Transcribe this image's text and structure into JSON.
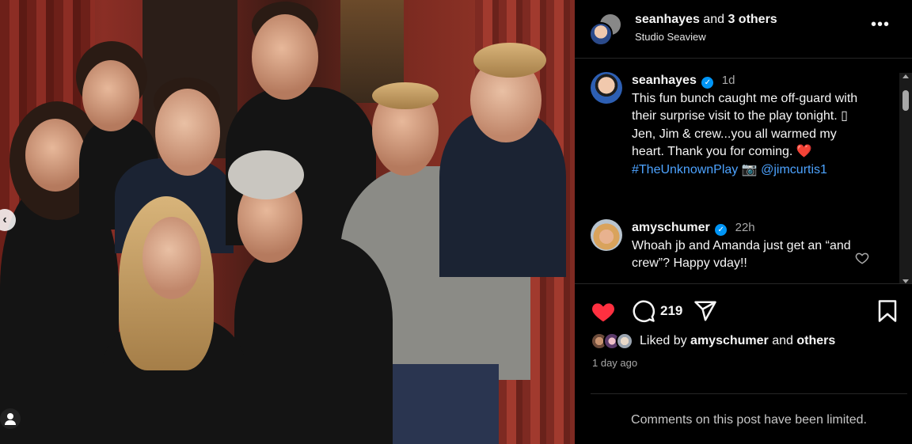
{
  "header": {
    "username": "seanhayes",
    "and_text": "and",
    "others": "3 others",
    "location": "Studio Seaview",
    "more_icon": "more-options-icon"
  },
  "comments": [
    {
      "username": "seanhayes",
      "verified": true,
      "time": "1d",
      "text_before": "This fun bunch caught me off-guard with their surprise visit to the play tonight. ▯ Jen, Jim & crew...you all warmed my heart. Thank you for coming. ",
      "heart": "❤️",
      "hashtag": "#TheUnknownPlay",
      "camera": " 📷 ",
      "mention": "@jimcurtis1"
    },
    {
      "username": "amyschumer",
      "verified": true,
      "time": "22h",
      "text": "Whoah jb and Amanda just get an “and crew”? Happy vday!!"
    }
  ],
  "actions": {
    "like_count": "219",
    "icons": [
      "heart-filled-icon",
      "comment-icon",
      "share-icon",
      "bookmark-icon"
    ],
    "liked_color": "#ff3040"
  },
  "likes": {
    "prefix": "Liked by",
    "user": "amyschumer",
    "and": "and",
    "others": "others"
  },
  "date": "1 day ago",
  "limited_notice": "Comments on this post have been limited.",
  "colors": {
    "accent": "#0095f6",
    "link": "#4da3ff",
    "background": "#000000"
  }
}
